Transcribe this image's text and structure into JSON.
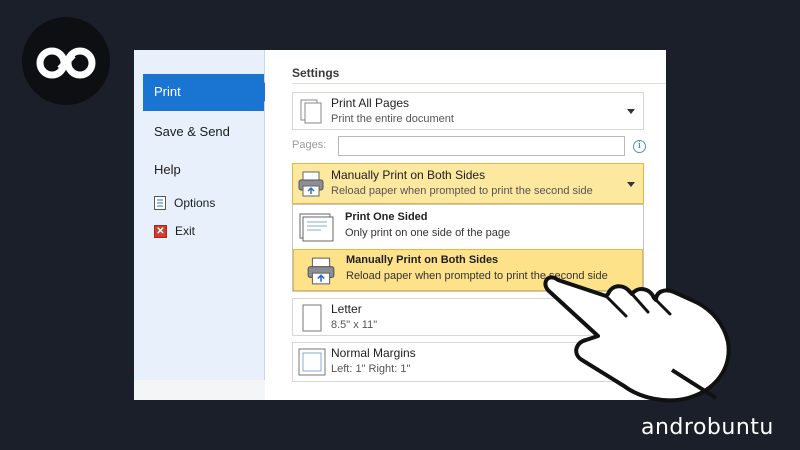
{
  "nav": {
    "print": "Print",
    "save_send": "Save & Send",
    "help": "Help",
    "options": "Options",
    "exit": "Exit",
    "icons": {
      "options": "document-options-icon",
      "exit": "exit-icon"
    }
  },
  "settings": {
    "title": "Settings",
    "print_pages": {
      "title": "Print All Pages",
      "subtitle": "Print the entire document"
    },
    "pages_label": "Pages:",
    "duplex": {
      "title": "Manually Print on Both Sides",
      "subtitle": "Reload paper when prompted to print the second side"
    },
    "duplex_options": [
      {
        "title": "Print One Sided",
        "subtitle": "Only print on one side of the page",
        "selected": false
      },
      {
        "title": "Manually Print on Both Sides",
        "subtitle": "Reload paper when prompted to print the second side",
        "selected": true
      }
    ],
    "paper": {
      "title": "Letter",
      "subtitle": "8.5\" x 11\""
    },
    "margins": {
      "title": "Normal Margins",
      "subtitle": "Left: 1\"   Right: 1\""
    }
  },
  "brand": "androbuntu",
  "colors": {
    "accent": "#1a74d2",
    "highlight": "#fde28a",
    "background": "#1b1f2a"
  }
}
